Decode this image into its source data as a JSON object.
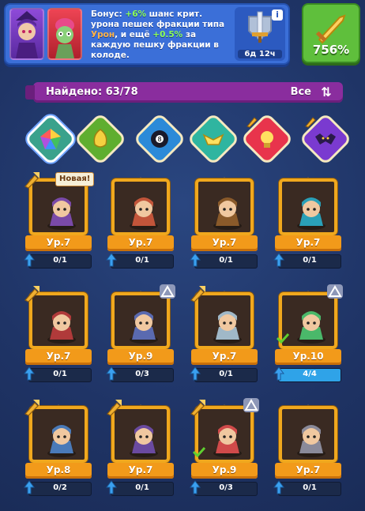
{
  "bonus": {
    "text_1": "Бонус: ",
    "crit_chance": "+6%",
    "text_2": " шанс крит. урона пешек фракции типа ",
    "faction_type": "Урон",
    "text_3": ", и ещё ",
    "extra": "+0.5%",
    "text_4": " за каждую пешку фракции в колоде.",
    "timer": "6д 12ч",
    "power": "756%"
  },
  "found_bar": {
    "label": "Найдено: 63/78",
    "filter": "Все"
  },
  "factions": [
    {
      "name": "all",
      "color": "#3aa28c",
      "selected": true,
      "locked": false
    },
    {
      "name": "nature",
      "color": "#5fae2f",
      "selected": false,
      "locked": false
    },
    {
      "name": "dark-orb",
      "color": "#2c8ad8",
      "selected": false,
      "locked": false
    },
    {
      "name": "holy",
      "color": "#2fb5a0",
      "selected": false,
      "locked": false
    },
    {
      "name": "light",
      "color": "#e8344c",
      "selected": false,
      "locked": true
    },
    {
      "name": "demon",
      "color": "#7a3ad0",
      "selected": false,
      "locked": true
    }
  ],
  "cards": [
    {
      "level": "Ур.7",
      "progress": "0/1",
      "fill": 0,
      "new": "Новая!",
      "upgrade": true,
      "tri": false,
      "check": false,
      "art": "#7a4aa8"
    },
    {
      "level": "Ур.7",
      "progress": "0/1",
      "fill": 0,
      "new": "",
      "upgrade": false,
      "tri": false,
      "check": false,
      "art": "#c2553a"
    },
    {
      "level": "Ур.7",
      "progress": "0/1",
      "fill": 0,
      "new": "",
      "upgrade": false,
      "tri": false,
      "check": false,
      "art": "#8a5a2a"
    },
    {
      "level": "Ур.7",
      "progress": "0/1",
      "fill": 0,
      "new": "",
      "upgrade": false,
      "tri": false,
      "check": false,
      "art": "#2aa0b8"
    },
    {
      "level": "Ур.7",
      "progress": "0/1",
      "fill": 0,
      "new": "",
      "upgrade": true,
      "tri": false,
      "check": false,
      "art": "#b03a3a"
    },
    {
      "level": "Ур.9",
      "progress": "0/3",
      "fill": 0,
      "new": "",
      "upgrade": false,
      "tri": true,
      "check": false,
      "art": "#5a6ab0"
    },
    {
      "level": "Ур.7",
      "progress": "0/1",
      "fill": 0,
      "new": "",
      "upgrade": true,
      "tri": false,
      "check": false,
      "art": "#a0b8c8"
    },
    {
      "level": "Ур.10",
      "progress": "4/4",
      "fill": 1,
      "new": "",
      "upgrade": false,
      "tri": true,
      "check": true,
      "art": "#4ab86a"
    },
    {
      "level": "Ур.8",
      "progress": "0/2",
      "fill": 0,
      "new": "",
      "upgrade": true,
      "tri": false,
      "check": false,
      "art": "#4a7ab8"
    },
    {
      "level": "Ур.7",
      "progress": "0/1",
      "fill": 0,
      "new": "",
      "upgrade": true,
      "tri": false,
      "check": false,
      "art": "#6a4aa0"
    },
    {
      "level": "Ур.9",
      "progress": "0/3",
      "fill": 0,
      "new": "",
      "upgrade": true,
      "tri": true,
      "check": true,
      "art": "#d04a4a"
    },
    {
      "level": "Ур.7",
      "progress": "0/1",
      "fill": 0,
      "new": "",
      "upgrade": false,
      "tri": false,
      "check": false,
      "art": "#8a8a9a"
    }
  ]
}
